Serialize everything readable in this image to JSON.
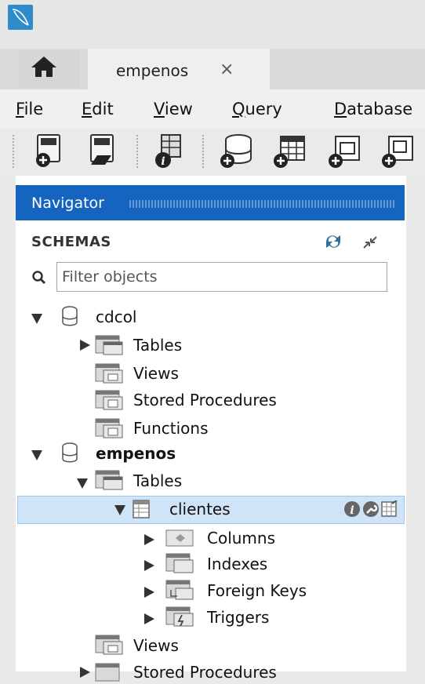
{
  "tabs": {
    "active_tab": "empenos",
    "close_glyph": "×"
  },
  "menu": {
    "items": [
      "File",
      "Edit",
      "View",
      "Query",
      "Database"
    ]
  },
  "toolbar": {
    "icons": [
      "new-sql-tab-icon",
      "open-sql-script-icon",
      "inspector-icon",
      "create-schema-icon",
      "create-table-icon",
      "create-view-icon",
      "create-procedure-icon"
    ]
  },
  "navigator": {
    "title": "Navigator",
    "schemas_label": "SCHEMAS",
    "filter_placeholder": "Filter objects",
    "tree": {
      "cdcol": {
        "name": "cdcol",
        "tables": "Tables",
        "views": "Views",
        "stored_procedures": "Stored Procedures",
        "functions": "Functions"
      },
      "empenos": {
        "name": "empenos",
        "tables": "Tables",
        "clientes": {
          "name": "clientes",
          "columns": "Columns",
          "indexes": "Indexes",
          "foreign_keys": "Foreign Keys",
          "triggers": "Triggers"
        },
        "views": "Views",
        "stored_procedures": "Stored Procedures"
      }
    }
  },
  "colors": {
    "nav_header": "#1565c0",
    "selection": "#cfe4f7"
  }
}
